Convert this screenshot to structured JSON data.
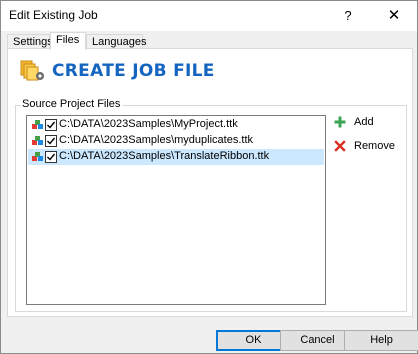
{
  "window": {
    "title": "Edit Existing Job",
    "help_glyph": "?",
    "close_glyph": "✕"
  },
  "tabs": [
    {
      "label": "Settings",
      "active": false
    },
    {
      "label": "Files",
      "active": true
    },
    {
      "label": "Languages",
      "active": false
    }
  ],
  "banner": {
    "title": "CREATE JOB FILE",
    "icon": "create-job-file-icon"
  },
  "source_files": {
    "group_label": "Source Project Files",
    "items": [
      {
        "label": "C:\\DATA\\2023Samples\\MyProject.ttk",
        "checked": true,
        "selected": false,
        "icon": "project-file-icon"
      },
      {
        "label": "C:\\DATA\\2023Samples\\myduplicates.ttk",
        "checked": true,
        "selected": false,
        "icon": "project-file-icon"
      },
      {
        "label": "C:\\DATA\\2023Samples\\TranslateRibbon.ttk",
        "checked": true,
        "selected": true,
        "icon": "project-file-icon"
      }
    ],
    "add_label": "Add",
    "remove_label": "Remove"
  },
  "footer": {
    "ok_label": "OK",
    "cancel_label": "Cancel",
    "help_label": "Help"
  },
  "colors": {
    "accent": "#1565c0",
    "selection": "#cce8ff",
    "add_green": "#3aa655",
    "remove_red": "#d93025"
  }
}
